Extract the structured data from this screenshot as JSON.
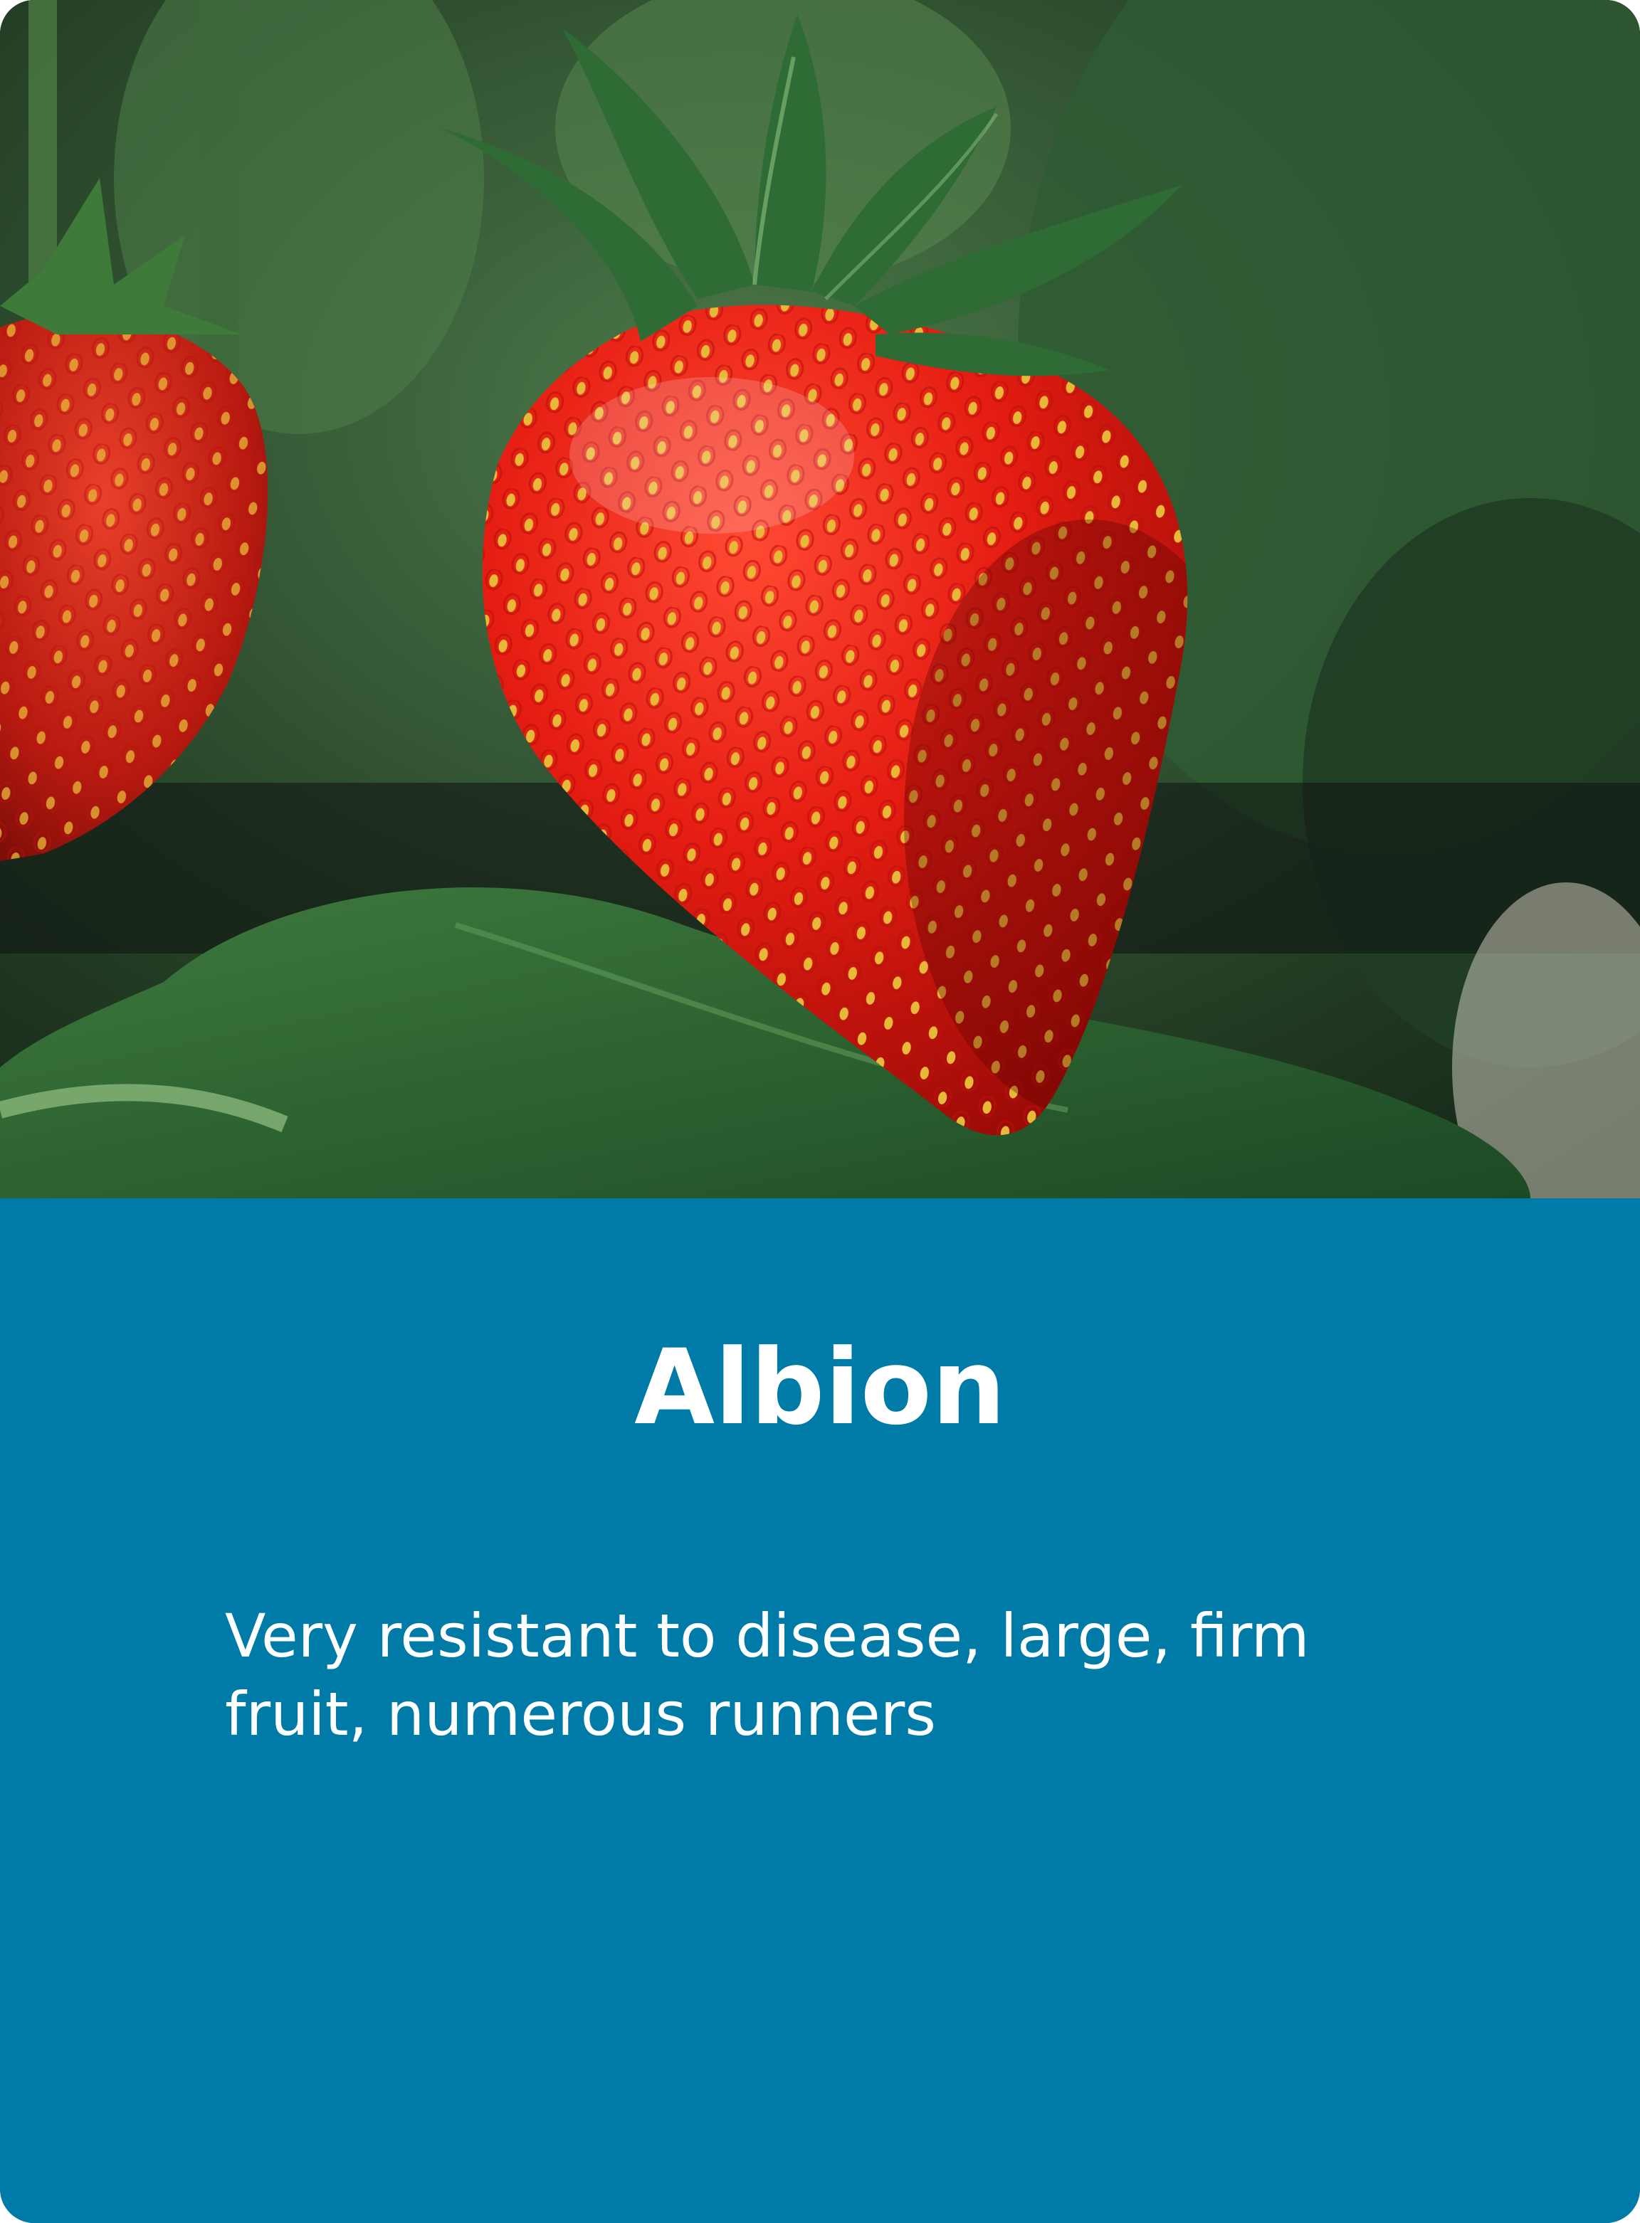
{
  "card": {
    "background_color": "#007ba7",
    "image": {
      "subject": "strawberry-photo",
      "alt": ""
    },
    "title": "Albion",
    "description": "Very resistant to disease, large, firm fruit, numerous runners"
  }
}
